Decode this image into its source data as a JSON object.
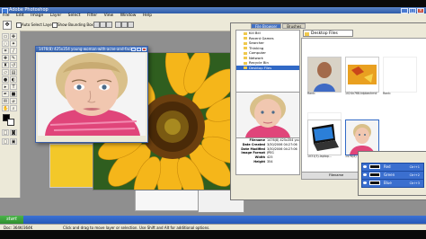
{
  "window": {
    "title": "Adobe Photoshop",
    "controls": {
      "minimize": "_",
      "maximize": "□",
      "close": "×"
    }
  },
  "menu": [
    "File",
    "Edit",
    "Image",
    "Layer",
    "Select",
    "Filter",
    "View",
    "Window",
    "Help"
  ],
  "options_bar": {
    "auto_select_layer": "Auto Select Layer",
    "show_bounding_box": "Show Bounding Box"
  },
  "document": {
    "title": "1476(8) 425x354 young-woman-with-acne-and-facial-"
  },
  "file_browser": {
    "tabs": [
      "File Browser",
      "Brushes"
    ],
    "active_tab": "File Browser",
    "path": "Desktop Files",
    "tree": [
      "Kill Bill",
      "Recent Games",
      "Searcher",
      "Thinking",
      "Computer",
      "Network",
      "Recycle Bin",
      "Desktop Files"
    ],
    "selected_folder": "Desktop Files",
    "metadata": [
      {
        "k": "Filename",
        "v": "1476(8) 425x354 you..."
      },
      {
        "k": "Date Created",
        "v": "3/30/2006 04:27:06"
      },
      {
        "k": "Date Modified",
        "v": "3/30/2006 04:27:06"
      },
      {
        "k": "Image Format",
        "v": "JPEG"
      },
      {
        "k": "Width",
        "v": "425"
      },
      {
        "k": "Height",
        "v": "354"
      }
    ],
    "thumbnails": [
      {
        "caption": "Rank:",
        "kind": "portrait"
      },
      {
        "caption": "1024x768-tdpbackrnd",
        "kind": "autumn"
      },
      {
        "caption": "Rank:",
        "kind": "blank"
      },
      {
        "caption": "Rank:",
        "kind": "blank2"
      },
      {
        "caption": "1031(3)-laptop...",
        "kind": "laptop"
      },
      {
        "caption": "1476(8) 425x354 you...",
        "kind": "face"
      }
    ],
    "bottom_sort": "Filename",
    "bottom_view": "Large with Rank"
  },
  "layers": [
    {
      "name": "Red",
      "shortcut": "Ctrl+1"
    },
    {
      "name": "Green",
      "shortcut": "Ctrl+2"
    },
    {
      "name": "Blue",
      "shortcut": "Ctrl+3"
    }
  ],
  "status": {
    "doc": "Doc: 364K/364K",
    "hint": "Click and drag to move layer or selection. Use Shift and Alt for additional options."
  },
  "taskbar": {
    "start_label": "start"
  }
}
